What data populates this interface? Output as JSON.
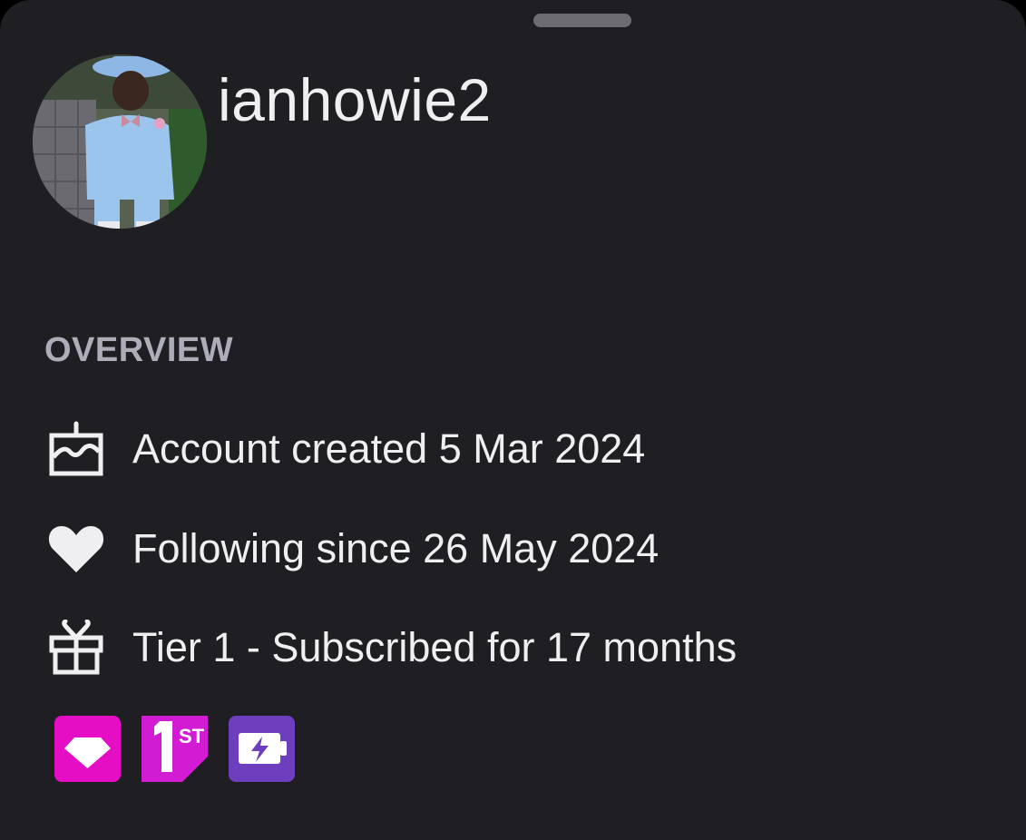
{
  "profile": {
    "username": "ianhowie2"
  },
  "overview": {
    "heading": "OVERVIEW",
    "items": [
      {
        "icon": "cake-icon",
        "text": "Account created 5 Mar 2024"
      },
      {
        "icon": "heart-icon",
        "text": "Following since 26 May 2024"
      },
      {
        "icon": "gift-icon",
        "text": "Tier 1 - Subscribed for 17 months"
      }
    ]
  },
  "badges": [
    {
      "icon": "diamond-badge-icon",
      "color": "#e50ec5"
    },
    {
      "icon": "first-badge-icon",
      "color": "#d21cd4",
      "label": "ST"
    },
    {
      "icon": "battery-badge-icon",
      "color": "#6d3fbe"
    }
  ],
  "colors": {
    "background": "#1f1f23",
    "text": "#efeff1",
    "muted": "#adadb8"
  }
}
